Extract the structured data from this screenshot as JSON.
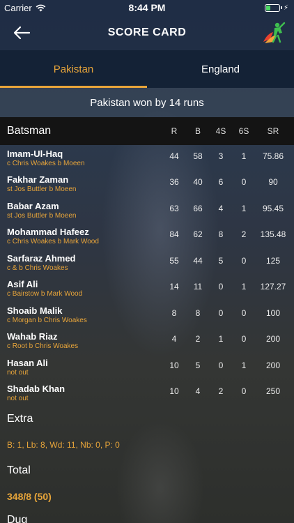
{
  "status": {
    "carrier": "Carrier",
    "time": "8:44 PM"
  },
  "nav": {
    "title": "SCORE CARD"
  },
  "tabs": [
    {
      "label": "Pakistan",
      "active": true
    },
    {
      "label": "England",
      "active": false
    }
  ],
  "result": "Pakistan won by 14 runs",
  "table": {
    "header": {
      "name": "Batsman",
      "r": "R",
      "b": "B",
      "fours": "4S",
      "sixes": "6S",
      "sr": "SR"
    },
    "rows": [
      {
        "name": "Imam-Ul-Haq",
        "dismissal": "c Chris Woakes b Moeen",
        "r": "44",
        "b": "58",
        "fours": "3",
        "sixes": "1",
        "sr": "75.86"
      },
      {
        "name": "Fakhar Zaman",
        "dismissal": "st Jos Buttler b Moeen",
        "r": "36",
        "b": "40",
        "fours": "6",
        "sixes": "0",
        "sr": "90"
      },
      {
        "name": "Babar Azam",
        "dismissal": "st Jos Buttler b Moeen",
        "r": "63",
        "b": "66",
        "fours": "4",
        "sixes": "1",
        "sr": "95.45"
      },
      {
        "name": "Mohammad Hafeez",
        "dismissal": "c Chris Woakes b Mark Wood",
        "r": "84",
        "b": "62",
        "fours": "8",
        "sixes": "2",
        "sr": "135.48"
      },
      {
        "name": "Sarfaraz Ahmed",
        "dismissal": "c & b Chris Woakes",
        "r": "55",
        "b": "44",
        "fours": "5",
        "sixes": "0",
        "sr": "125"
      },
      {
        "name": "Asif Ali",
        "dismissal": "c Bairstow b Mark Wood",
        "r": "14",
        "b": "11",
        "fours": "0",
        "sixes": "1",
        "sr": "127.27"
      },
      {
        "name": "Shoaib Malik",
        "dismissal": "c Morgan b Chris Woakes",
        "r": "8",
        "b": "8",
        "fours": "0",
        "sixes": "0",
        "sr": "100"
      },
      {
        "name": "Wahab Riaz",
        "dismissal": "c Root b Chris Woakes",
        "r": "4",
        "b": "2",
        "fours": "1",
        "sixes": "0",
        "sr": "200"
      },
      {
        "name": "Hasan Ali",
        "dismissal": "not out",
        "r": "10",
        "b": "5",
        "fours": "0",
        "sixes": "1",
        "sr": "200"
      },
      {
        "name": " Shadab Khan",
        "dismissal": "not out",
        "r": "10",
        "b": "4",
        "fours": "2",
        "sixes": "0",
        "sr": "250"
      }
    ]
  },
  "extra": {
    "title": "Extra",
    "value": "B: 1, Lb: 8, Wd: 11, Nb: 0, P: 0"
  },
  "total": {
    "title": "Total",
    "value": "348/8 (50)"
  },
  "next_section": {
    "title": "Dug"
  },
  "colors": {
    "accent": "#e8a53a",
    "nav_bg": "#1c2840",
    "header_bg": "#141414"
  }
}
